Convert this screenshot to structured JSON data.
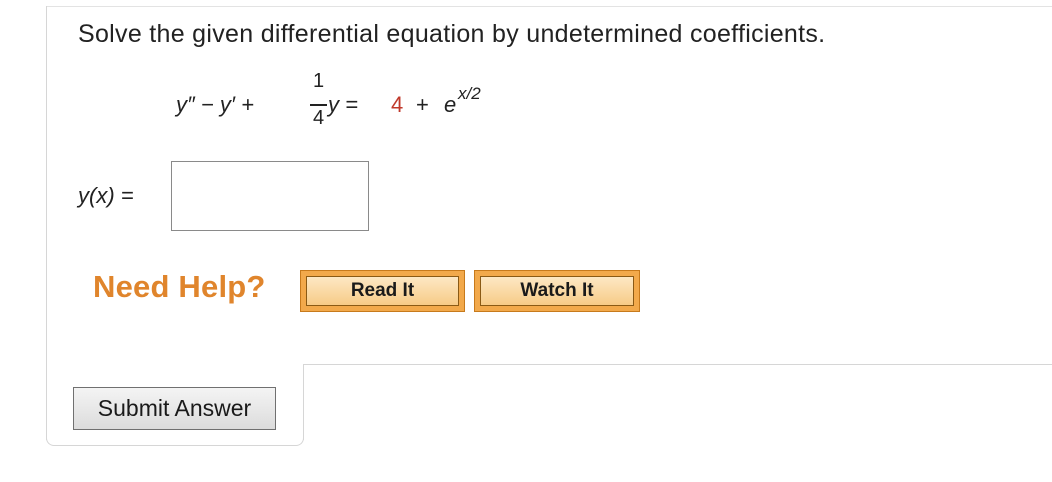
{
  "question": {
    "text": "Solve the given differential equation by undetermined coefficients."
  },
  "equation": {
    "lhs_prefix": "y″ − y′ +",
    "frac_num": "1",
    "frac_den": "4",
    "after_frac": "y =",
    "rhs_constant": "4",
    "plus": "+",
    "exp_base": "e",
    "exp_power": "x/2",
    "constant_color": "#c0392b"
  },
  "answer": {
    "label": "y(x) =",
    "value": ""
  },
  "help": {
    "label": "Need Help?",
    "read_it": "Read It",
    "watch_it": "Watch It",
    "accent_color": "#e0852c"
  },
  "submit": {
    "label": "Submit Answer"
  }
}
